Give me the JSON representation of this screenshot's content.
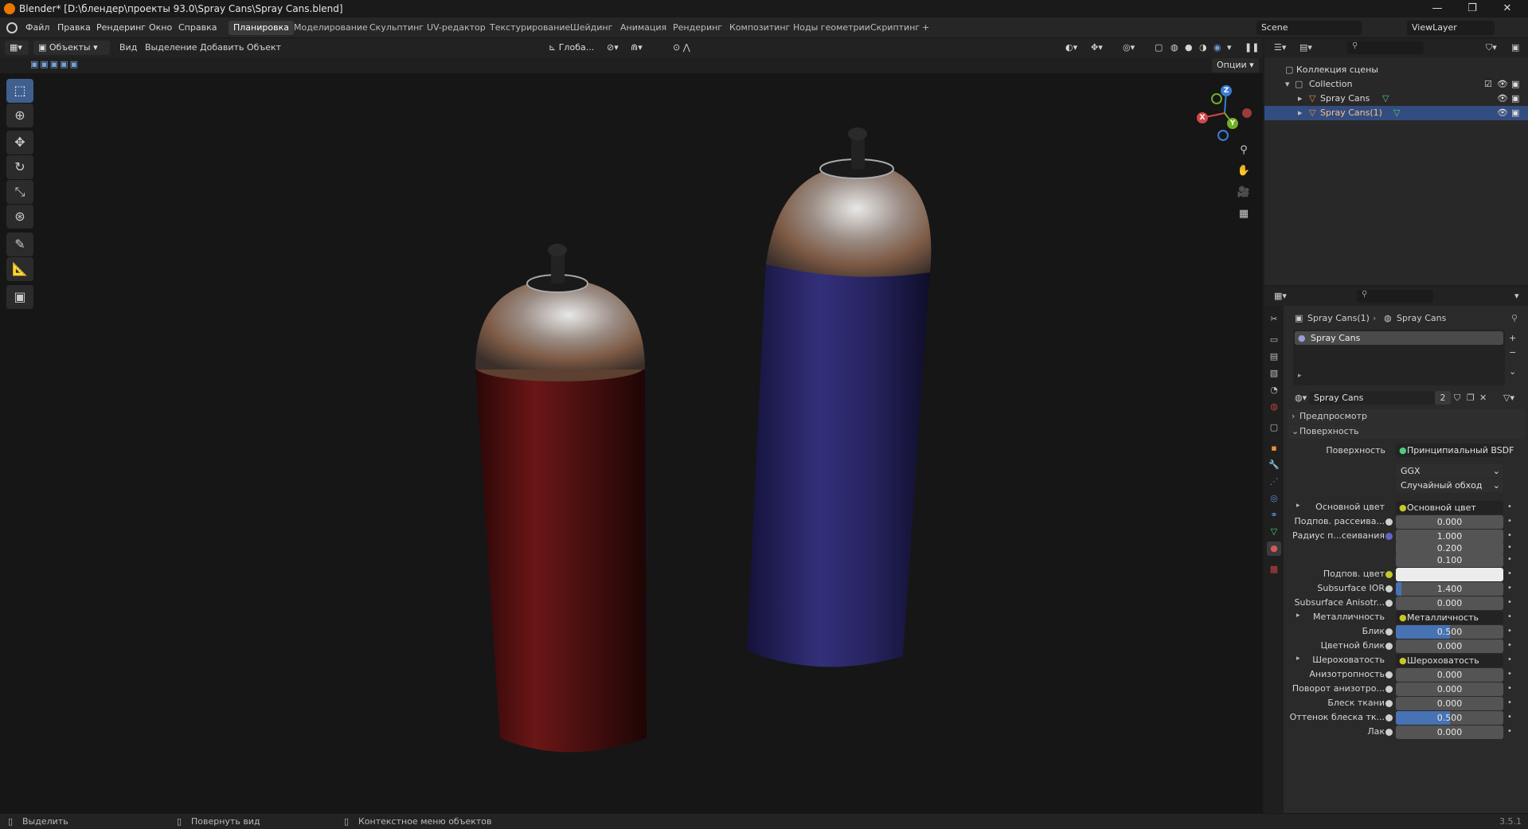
{
  "titlebar": {
    "title": "Blender* [D:\\блендер\\проекты 93.0\\Spray Cans\\Spray Cans.blend]",
    "min": "—",
    "max": "❐",
    "close": "✕"
  },
  "menu": {
    "file": "Файл",
    "edit": "Правка",
    "render": "Рендеринг",
    "window": "Окно",
    "help": "Справка"
  },
  "workspaces": [
    "Планировка",
    "Моделирование",
    "Скульптинг",
    "UV-редактор",
    "Текстурирование",
    "Шейдинг",
    "Анимация",
    "Рендеринг",
    "Композитинг",
    "Ноды геометрии",
    "Скриптинг"
  ],
  "workspace_add": "+",
  "scene": {
    "name": "Scene",
    "viewlayer": "ViewLayer"
  },
  "viewport": {
    "mode": "Объекты",
    "view": "Вид",
    "select": "Выделение",
    "add": "Добавить",
    "object": "Объект",
    "transform": "Глоба...",
    "options": "Опции"
  },
  "gizmo": {
    "z": "Z",
    "y": "Y",
    "x": "X"
  },
  "outliner": {
    "scene_collection": "Коллекция сцены",
    "collection": "Collection",
    "items": [
      "Spray Cans",
      "Spray Cans(1)"
    ]
  },
  "props": {
    "breadcrumb_obj": "Spray Cans(1)",
    "breadcrumb_mat": "Spray Cans",
    "slot": "Spray Cans",
    "material_name": "Spray Cans",
    "users": "2",
    "preview": "Предпросмотр",
    "surface_section": "Поверхность",
    "surface_label": "Поверхность",
    "surface_value": "Принципиальный BSDF",
    "distribution": "GGX",
    "ss_method": "Случайный обход",
    "rows": [
      {
        "label": "Основной цвет",
        "link": "Основной цвет"
      },
      {
        "label": "Подпов. рассеива...",
        "value": "0.000"
      },
      {
        "label": "Радиус п...сеивания",
        "value": "1.000"
      },
      {
        "label": "",
        "value": "0.200"
      },
      {
        "label": "",
        "value": "0.100"
      },
      {
        "label": "Подпов. цвет",
        "value": ""
      },
      {
        "label": "Subsurface IOR",
        "value": "1.400",
        "fill": 0.05
      },
      {
        "label": "Subsurface Anisotr...",
        "value": "0.000"
      },
      {
        "label": "Металличность",
        "link": "Металличность"
      },
      {
        "label": "Блик",
        "value": "0.500",
        "fill": 0.5
      },
      {
        "label": "Цветной блик",
        "value": "0.000"
      },
      {
        "label": "Шероховатость",
        "link": "Шероховатость"
      },
      {
        "label": "Анизотропность",
        "value": "0.000"
      },
      {
        "label": "Поворот анизотро...",
        "value": "0.000"
      },
      {
        "label": "Блеск ткани",
        "value": "0.000"
      },
      {
        "label": "Оттенок блеска тк...",
        "value": "0.500",
        "fill": 0.5
      },
      {
        "label": "Лак",
        "value": "0.000"
      }
    ]
  },
  "status": {
    "select": "Выделить",
    "rotate": "Повернуть вид",
    "context": "Контекстное меню объектов",
    "version": "3.5.1"
  },
  "colors": {
    "accent": "#4772b3",
    "selection": "#334d80",
    "can_red": "#5a1414",
    "can_blue": "#2a2766"
  }
}
